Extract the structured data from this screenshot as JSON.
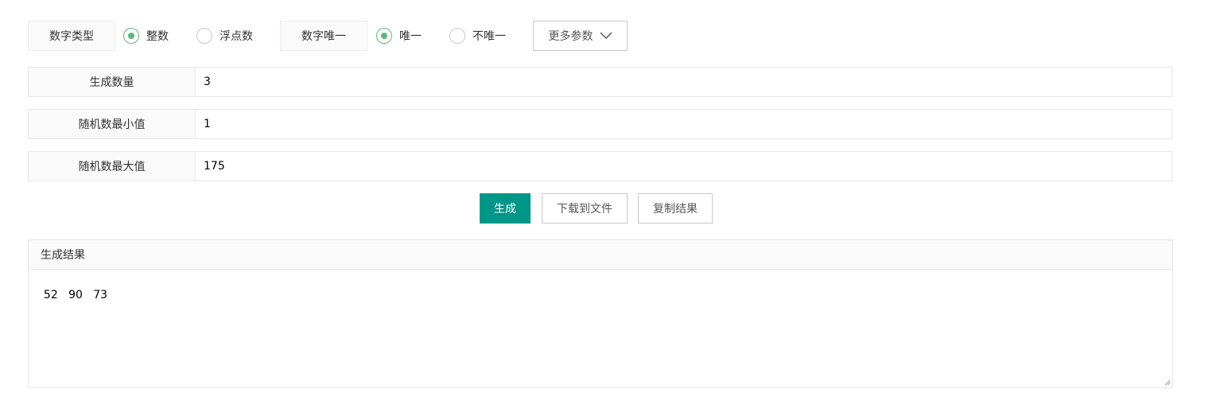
{
  "options": {
    "number_type_label": "数字类型",
    "integer_label": "整数",
    "float_label": "浮点数",
    "number_unique_label": "数字唯一",
    "unique_label": "唯一",
    "not_unique_label": "不唯一",
    "more_params_label": "更多参数",
    "number_type_selected": "整数",
    "unique_selected": "唯一"
  },
  "params": {
    "count_label": "生成数量",
    "count_value": "3",
    "min_label": "随机数最小值",
    "min_value": "1",
    "max_label": "随机数最大值",
    "max_value": "175"
  },
  "actions": {
    "generate_label": "生成",
    "download_label": "下载到文件",
    "copy_label": "复制结果"
  },
  "result": {
    "title": "生成结果",
    "content": "52   90   73"
  },
  "colors": {
    "accent": "#009688",
    "radio_checked": "#5fb878"
  }
}
